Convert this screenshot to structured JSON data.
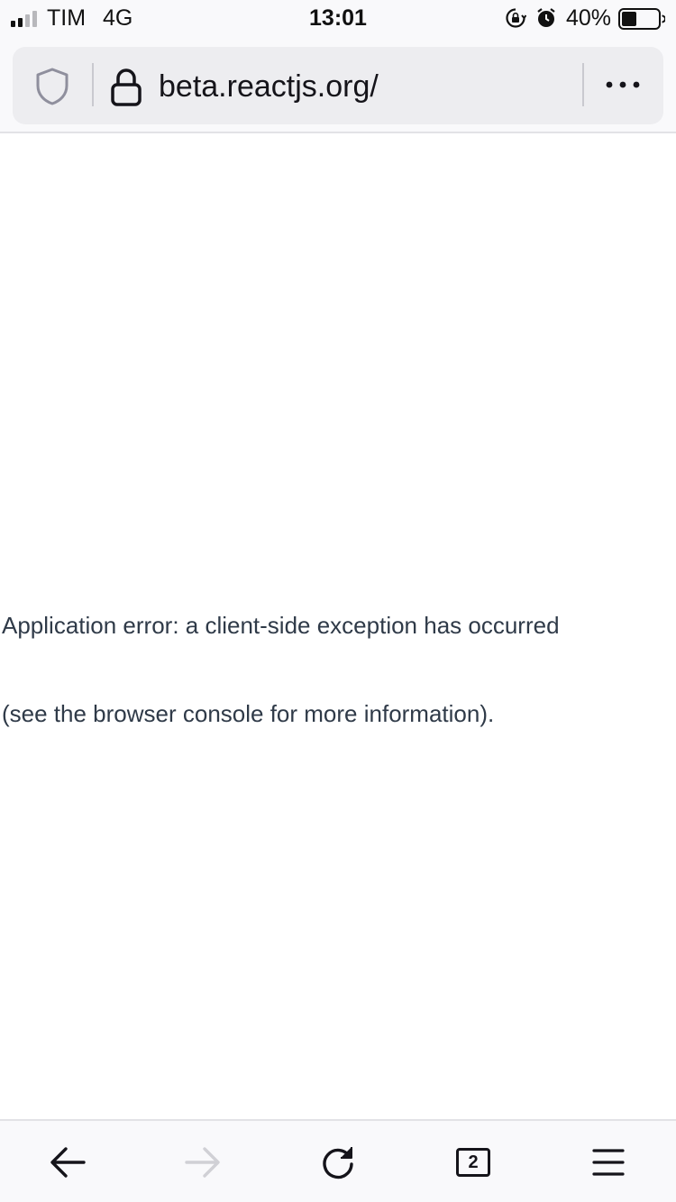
{
  "status_bar": {
    "carrier": "TIM",
    "network": "4G",
    "time": "13:01",
    "battery_percent": "40%",
    "battery_level": 0.4,
    "signal_bars_filled": 2,
    "signal_bars_total": 4,
    "icons": [
      "signal-icon",
      "rotation-lock-icon",
      "alarm-icon",
      "battery-icon"
    ]
  },
  "url_bar": {
    "url": "beta.reactjs.org/",
    "icons": [
      "shield-icon",
      "lock-icon",
      "more-options-icon"
    ]
  },
  "content": {
    "error_line_1": "Application error: a client-side exception has occurred",
    "error_line_2": "(see the browser console for more information)."
  },
  "bottom_toolbar": {
    "tab_count": "2",
    "icons": [
      "back-arrow-icon",
      "forward-arrow-icon",
      "reload-icon",
      "tabs-icon",
      "menu-icon"
    ],
    "forward_enabled": false
  },
  "colors": {
    "chrome_background": "#f9f9fb",
    "url_pill": "#ededf0",
    "error_text": "#2f3a48",
    "disabled_icon": "#d0d0d5"
  }
}
